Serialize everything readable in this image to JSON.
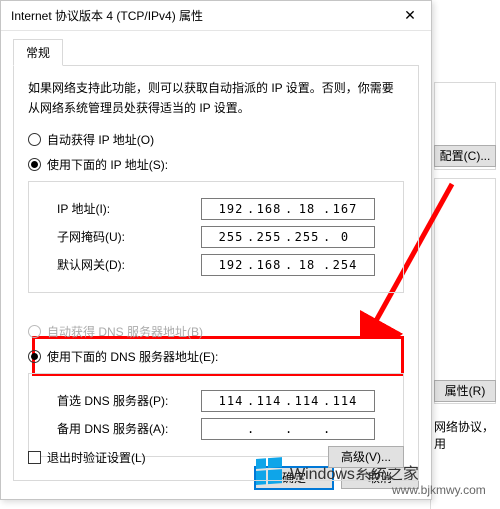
{
  "dialog": {
    "title": "Internet 协议版本 4 (TCP/IPv4) 属性",
    "tab_general": "常规",
    "description": "如果网络支持此功能，则可以获取自动指派的 IP 设置。否则，你需要从网络系统管理员处获得适当的 IP 设置。",
    "ip_section": {
      "radio_auto": "自动获得 IP 地址(O)",
      "radio_manual": "使用下面的 IP 地址(S):",
      "ip_label": "IP 地址(I):",
      "ip_value": [
        "192",
        "168",
        "18",
        "167"
      ],
      "mask_label": "子网掩码(U):",
      "mask_value": [
        "255",
        "255",
        "255",
        "0"
      ],
      "gw_label": "默认网关(D):",
      "gw_value": [
        "192",
        "168",
        "18",
        "254"
      ]
    },
    "dns_section": {
      "radio_auto": "自动获得 DNS 服务器地址(B)",
      "radio_manual": "使用下面的 DNS 服务器地址(E):",
      "pref_label": "首选 DNS 服务器(P):",
      "pref_value": [
        "114",
        "114",
        "114",
        "114"
      ],
      "alt_label": "备用 DNS 服务器(A):",
      "alt_value": [
        "",
        "",
        "",
        ""
      ]
    },
    "validate_checkbox": "退出时验证设置(L)",
    "advanced_btn": "高级(V)...",
    "ok_btn": "确定",
    "cancel_btn": "取消"
  },
  "parent_window": {
    "configure_btn": "配置(C)...",
    "properties_btn": "属性(R)",
    "desc_text": "网络协议，用"
  },
  "watermark": {
    "text": "Windows系统之家",
    "url": "www.bjkmwy.com"
  }
}
